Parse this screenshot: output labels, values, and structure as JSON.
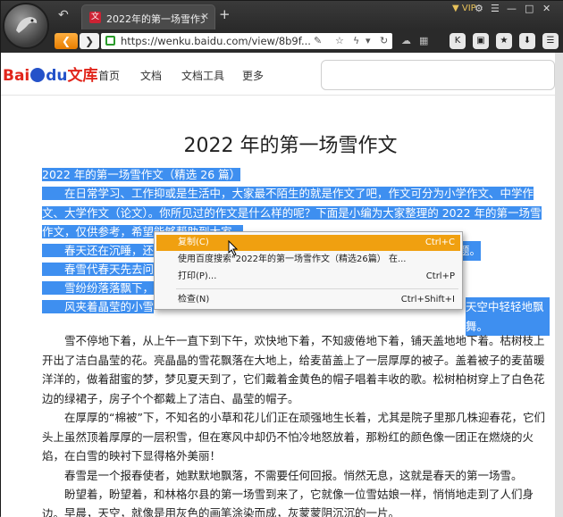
{
  "browser": {
    "tab_title": "2022年的第一场雪作文",
    "tab_favicon": "文",
    "url": "https://wenku.baidu.com/view/8b9f...",
    "vip_label": "VIP"
  },
  "site": {
    "logo_text_1": "Bai",
    "logo_text_2": "du",
    "logo_text_3": "文库",
    "nav": [
      "首页",
      "文档",
      "文档工具",
      "更多"
    ]
  },
  "doc": {
    "title": "2022 年的第一场雪作文",
    "sel_line1": "2022 年的第一场雪作文（精选 26 篇）",
    "sel_p1": "在日常学习、工作抑或是生活中，大家最不陌生的就是作文了吧，作文可分为小学作文、中学作文、大学作文（论文）。你所见过的作文是什么样的呢？下面是小编为大家整理的 2022 年的第一场雪作文，仅供参考，希望能够帮助到大家。",
    "sel_p2": "春天还在沉睡，还",
    "sel_p2b": "题。",
    "sel_p3": "春雪代春天先去问",
    "sel_p4": "雪纷纷落落飘下，",
    "sel_p5": "风夹着晶莹的小雪",
    "sel_p5b": "天空中轻轻地飘舞。",
    "p6": "雪不停地下着，从上午一直下到下午，欢快地下着，不知疲倦地下着，铺天盖地地下着。枯树枝上开出了洁白晶莹的花。亮晶晶的雪花飘落在大地上，给麦苗盖上了一层厚厚的被子。盖着被子的麦苗暖洋洋的，做着甜蜜的梦，梦见夏天到了，它们戴着金黄色的帽子唱着丰收的歌。松树柏树穿上了白色花边的绿裙子，房子个个都戴上了洁白、晶莹的帽子。",
    "p7": "在厚厚的“棉被”下，不知名的小草和花儿们正在顽强地生长着，尤其是院子里那几株迎春花，它们头上虽然顶着厚厚的一层积雪，但在寒风中却仍不怕冷地怒放着，那粉红的颜色像一团正在燃烧的火焰，在白雪的映衬下显得格外美丽！",
    "p8": "春雪是一个报春使者，她默默地飘落，不需要任何回报。悄然无息，这就是春天的第一场雪。",
    "p9": "盼望着，盼望着，和林格尔县的第一场雪到来了，它就像一位雪姑娘一样，悄悄地走到了人们身边。",
    "p10": "早晨，天空，就像是用灰色的画笔涂染而成，灰蒙蒙阴沉沉的一片。"
  },
  "context_menu": {
    "copy": "复制(C)",
    "copy_key": "Ctrl+C",
    "search": "使用百度搜索\"2022年的第一场雪作文（精选26篇）     在...",
    "print": "打印(P)...",
    "print_key": "Ctrl+P",
    "inspect": "检查(N)",
    "inspect_key": "Ctrl+Shift+I"
  },
  "colors": {
    "selection": "#3e8ff0",
    "menu_highlight": "#f0a010",
    "back_button": "#f08c00",
    "baidu_red": "#e1251b",
    "baidu_blue": "#2452c9"
  }
}
